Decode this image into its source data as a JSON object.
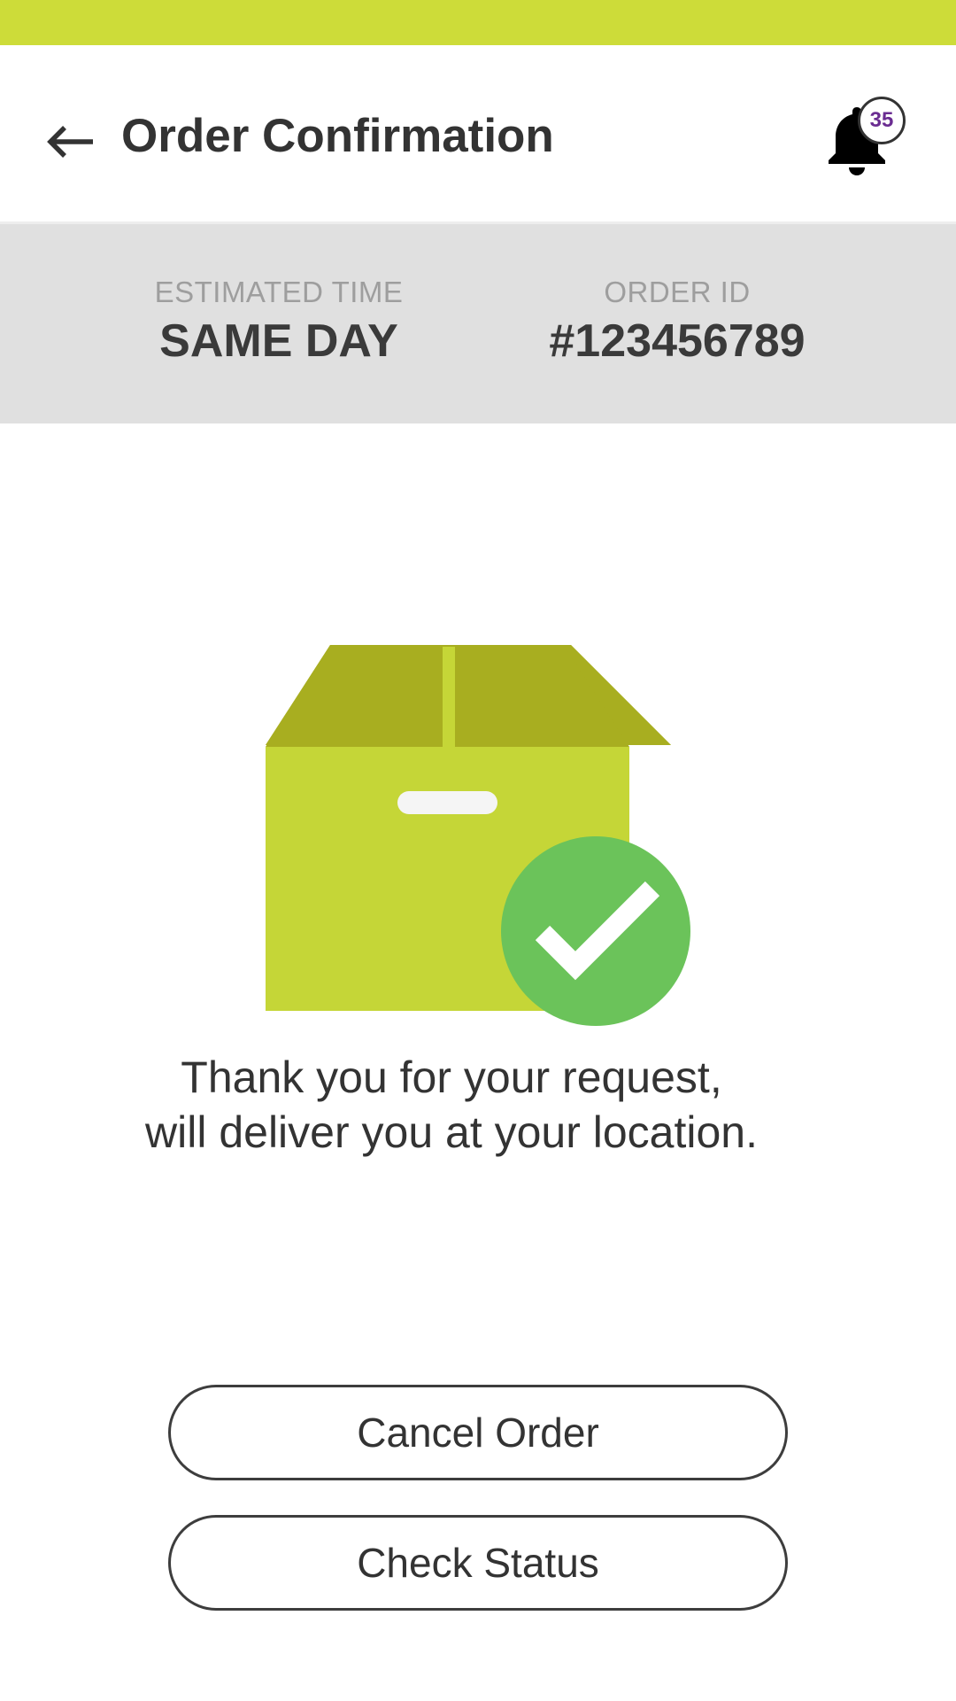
{
  "status_bar": {
    "color": "#cddc39"
  },
  "header": {
    "back_icon": "arrow-left-icon",
    "title": "Order Confirmation",
    "notification_icon": "bell-icon",
    "notification_count": "35"
  },
  "info": {
    "estimated_time_label": "ESTIMATED TIME",
    "estimated_time_value": "SAME DAY",
    "order_id_label": "ORDER ID",
    "order_id_value": "#123456789"
  },
  "illustration": {
    "box_icon": "package-box-icon",
    "check_icon": "check-circle-icon",
    "box_color": "#c5d637",
    "box_lid_color": "#a8ae20",
    "check_color": "#6bc35a"
  },
  "message": {
    "line1": "Thank you for your request,",
    "line2": "will deliver you at your location."
  },
  "actions": {
    "cancel_label": "Cancel Order",
    "status_label": "Check Status"
  }
}
